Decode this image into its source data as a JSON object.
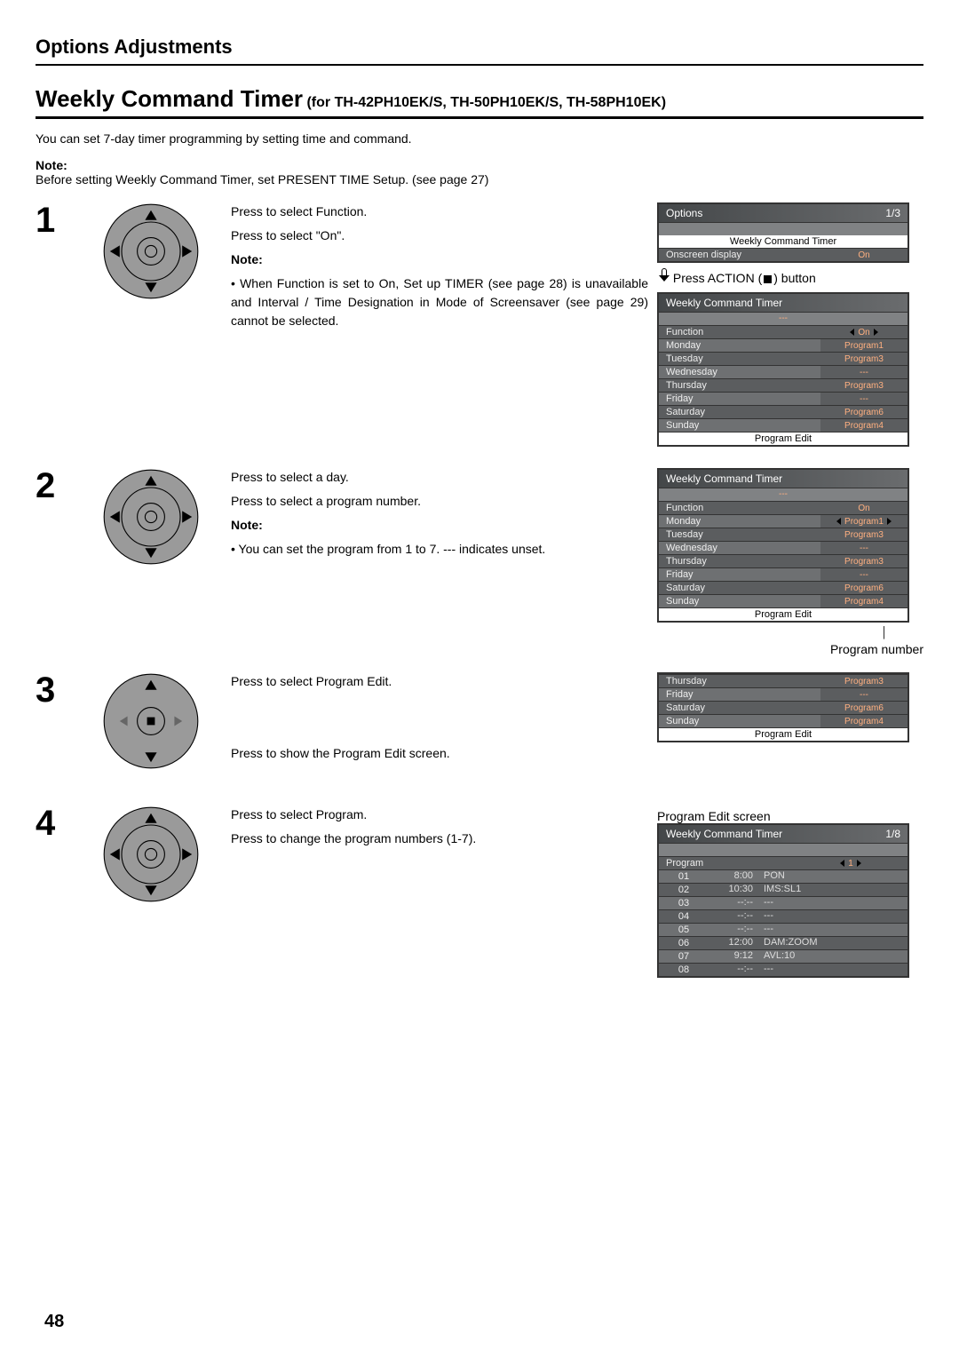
{
  "header": "Options Adjustments",
  "title_main": "Weekly Command Timer",
  "title_sub": " (for TH-42PH10EK/S, TH-50PH10EK/S, TH-58PH10EK)",
  "intro": "You can set 7-day timer programming by setting time and command.",
  "global_note_label": "Note:",
  "global_note_text": "Before setting Weekly Command Timer, set PRESENT TIME Setup. (see page 27)",
  "page_number": "48",
  "step1": {
    "num": "1",
    "line1": "Press to select Function.",
    "line2": "Press to select \"On\".",
    "note_label": "Note:",
    "note_bullet": "• When Function is set to On, Set up TIMER (see page 28) is unavailable and Interval / Time Designation in Mode of Screensaver (see page 29) cannot be selected."
  },
  "step2": {
    "num": "2",
    "line1": "Press to select a day.",
    "line2": "Press to select a program number.",
    "note_label": "Note:",
    "note_bullet": "• You can set the program from 1 to 7.    --- indicates unset."
  },
  "step3": {
    "num": "3",
    "line1": "Press to select Program Edit.",
    "line2": "Press to show the Program Edit screen."
  },
  "step4": {
    "num": "4",
    "line1": "Press to select Program.",
    "line2": "Press to change the program numbers (1-7)."
  },
  "action_line": "Press ACTION (■) button",
  "osd_options": {
    "title": "Options",
    "page": "1/3",
    "row1": "Weekly Command Timer",
    "row2_lbl": "Onscreen display",
    "row2_val": "On"
  },
  "osd_wct1": {
    "title": "Weekly Command Timer",
    "rows": [
      {
        "lbl": "Function",
        "val": "On",
        "arrows": true
      },
      {
        "lbl": "Monday",
        "val": "Program1"
      },
      {
        "lbl": "Tuesday",
        "val": "Program3"
      },
      {
        "lbl": "Wednesday",
        "val": "---"
      },
      {
        "lbl": "Thursday",
        "val": "Program3"
      },
      {
        "lbl": "Friday",
        "val": "---"
      },
      {
        "lbl": "Saturday",
        "val": "Program6"
      },
      {
        "lbl": "Sunday",
        "val": "Program4"
      }
    ],
    "footer": "Program Edit"
  },
  "osd_wct2": {
    "title": "Weekly Command Timer",
    "rows": [
      {
        "lbl": "Function",
        "val": "On"
      },
      {
        "lbl": "Monday",
        "val": "Program1",
        "arrows": true
      },
      {
        "lbl": "Tuesday",
        "val": "Program3"
      },
      {
        "lbl": "Wednesday",
        "val": "---"
      },
      {
        "lbl": "Thursday",
        "val": "Program3"
      },
      {
        "lbl": "Friday",
        "val": "---"
      },
      {
        "lbl": "Saturday",
        "val": "Program6"
      },
      {
        "lbl": "Sunday",
        "val": "Program4"
      }
    ],
    "footer": "Program Edit",
    "caption": "Program number"
  },
  "osd_wct3": {
    "rows": [
      {
        "lbl": "Thursday",
        "val": "Program3"
      },
      {
        "lbl": "Friday",
        "val": "---"
      },
      {
        "lbl": "Saturday",
        "val": "Program6"
      },
      {
        "lbl": "Sunday",
        "val": "Program4"
      }
    ],
    "footer": "Program Edit"
  },
  "osd_pe": {
    "caption": "Program Edit screen",
    "title": "Weekly Command Timer",
    "page": "1/8",
    "program_lbl": "Program",
    "program_val": "1",
    "rows": [
      {
        "n": "01",
        "t": "8:00",
        "c": "PON"
      },
      {
        "n": "02",
        "t": "10:30",
        "c": "IMS:SL1"
      },
      {
        "n": "03",
        "t": "--:--",
        "c": "---"
      },
      {
        "n": "04",
        "t": "--:--",
        "c": "---"
      },
      {
        "n": "05",
        "t": "--:--",
        "c": "---"
      },
      {
        "n": "06",
        "t": "12:00",
        "c": "DAM:ZOOM"
      },
      {
        "n": "07",
        "t": "9:12",
        "c": "AVL:10"
      },
      {
        "n": "08",
        "t": "--:--",
        "c": "---"
      }
    ]
  }
}
